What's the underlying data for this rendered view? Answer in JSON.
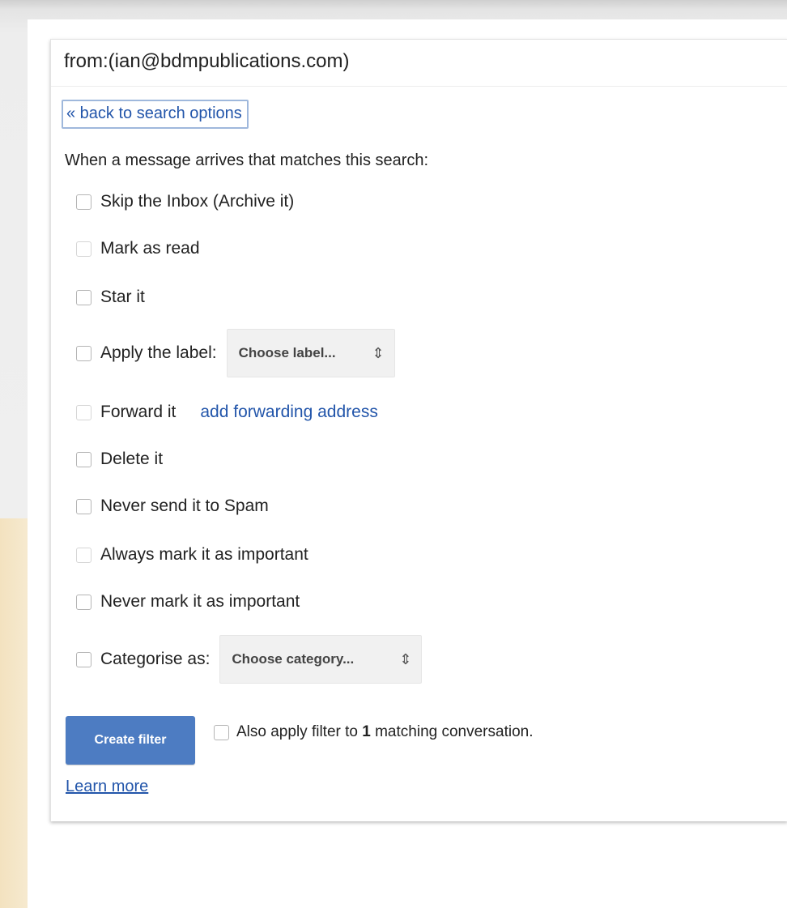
{
  "filter_search": {
    "query": "from:(ian@bdmpublications.com)"
  },
  "back_link": "« back to search options",
  "intro_text": "When a message arrives that matches this search:",
  "options": [
    {
      "label": "Skip the Inbox (Archive it)",
      "checked": false
    },
    {
      "label": "Mark as read",
      "checked": false
    },
    {
      "label": "Star it",
      "checked": false
    },
    {
      "label": "Apply the label:",
      "checked": false
    },
    {
      "label": "Forward it",
      "checked": false
    },
    {
      "label": "Delete it",
      "checked": false
    },
    {
      "label": "Never send it to Spam",
      "checked": false
    },
    {
      "label": "Always mark it as important",
      "checked": false
    },
    {
      "label": "Never mark it as important",
      "checked": false
    },
    {
      "label": "Categorise as:",
      "checked": false
    }
  ],
  "label_select": {
    "value": "Choose label...",
    "arrow_icon": "updown-arrows-icon"
  },
  "forward_link": "add forwarding address",
  "category_select": {
    "value": "Choose category...",
    "arrow_icon": "updown-arrows-icon"
  },
  "create_button": "Create filter",
  "apply_also": {
    "prefix": "Also apply filter to ",
    "count": "1",
    "suffix": " matching conversation.",
    "checked": false
  },
  "learn_more": "Learn more",
  "colors": {
    "link": "#2255aa",
    "button": "#4d7cc2",
    "button_text": "#ffffff"
  }
}
